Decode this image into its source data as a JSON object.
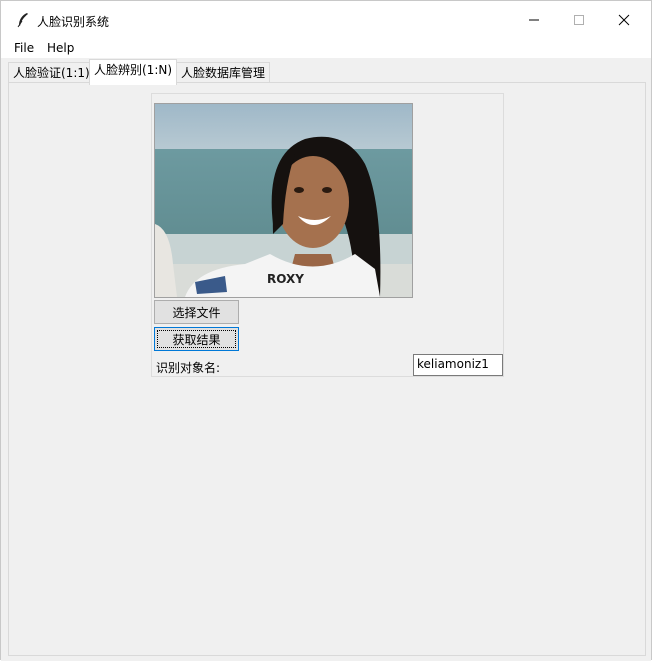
{
  "window": {
    "title": "人脸识别系统",
    "controls": {
      "minimize": "minimize-icon",
      "maximize": "maximize-icon",
      "close": "close-icon"
    }
  },
  "menubar": {
    "items": [
      {
        "label": "File"
      },
      {
        "label": "Help"
      }
    ]
  },
  "tabs": [
    {
      "label": "人脸验证(1:1)",
      "active": false
    },
    {
      "label": "人脸辨别(1:N)",
      "active": true
    },
    {
      "label": "人脸数据库管理",
      "active": false
    }
  ],
  "panel": {
    "choose_file_button": "选择文件",
    "get_result_button": "获取结果",
    "result_label": "识别对象名:",
    "result_value": "keliamoniz1",
    "photo_shirt_text": "ROXY"
  },
  "colors": {
    "window_bg": "#f0f0f0",
    "titlebar_bg": "#ffffff",
    "button_bg": "#e1e1e1"
  }
}
